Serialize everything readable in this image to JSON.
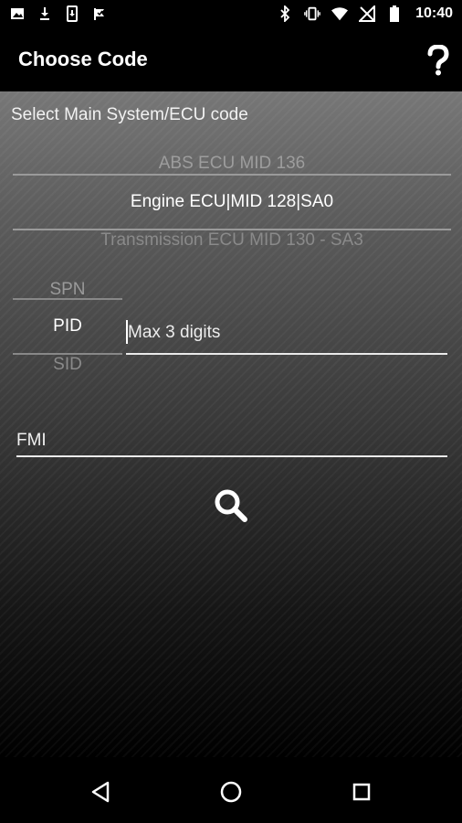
{
  "status_bar": {
    "time": "10:40",
    "left_icons": [
      "image-icon",
      "download-icon",
      "phone-update-icon",
      "flag-check-icon"
    ],
    "right_icons": [
      "bluetooth-icon",
      "vibrate-icon",
      "wifi-icon",
      "signal-off-icon",
      "battery-icon"
    ]
  },
  "app_bar": {
    "title": "Choose Code",
    "help_icon": "question-mark-icon"
  },
  "ecu_picker": {
    "label": "Select Main System/ECU code",
    "previous": "ABS ECU MID 136",
    "selected": "Engine ECU|MID 128|SA0",
    "next": "Transmission ECU MID 130 - SA3"
  },
  "code_type_picker": {
    "previous": "SPN",
    "selected": "PID",
    "next": "SID"
  },
  "code_input": {
    "value": "",
    "placeholder": "Max 3 digits"
  },
  "fmi_input": {
    "value": "",
    "placeholder": "FMI"
  },
  "search_button": {
    "icon": "search-icon"
  },
  "nav_bar": {
    "icons": [
      "back-triangle-icon",
      "home-circle-icon",
      "recents-square-icon"
    ]
  },
  "colors": {
    "background_top": "#777777",
    "background_bottom": "#000000",
    "text": "#ffffff",
    "muted_text": "#9a9a9a"
  }
}
